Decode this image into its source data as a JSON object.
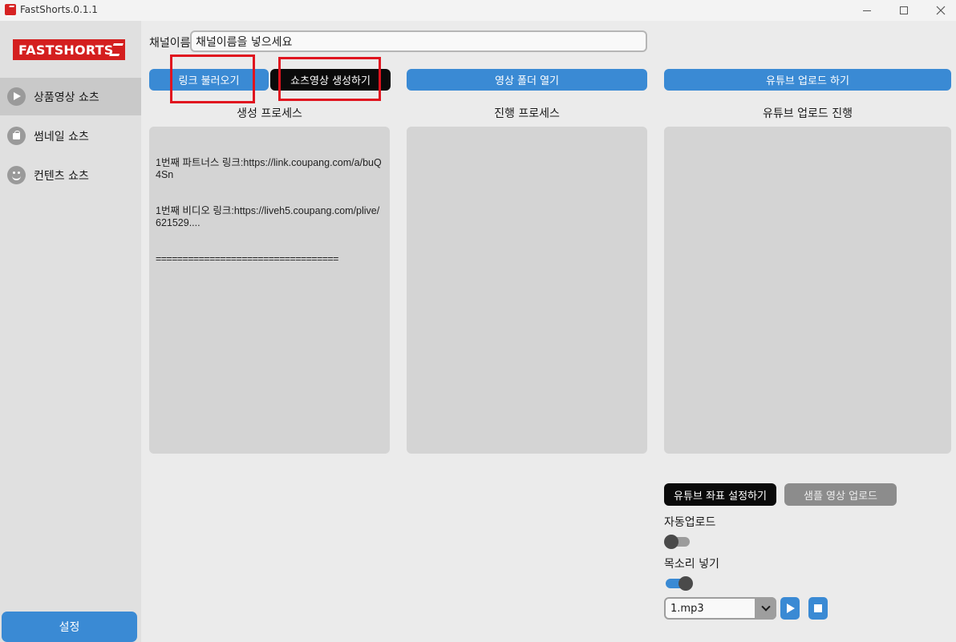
{
  "window": {
    "title": "FastShorts.0.1.1",
    "controls": [
      "minimize",
      "maximize",
      "close"
    ]
  },
  "sidebar": {
    "logo_text": "FASTSHORTS",
    "items": [
      {
        "label": "상품영상 쇼츠",
        "icon": "play-icon",
        "active": true
      },
      {
        "label": "썸네일 쇼츠",
        "icon": "bag-icon",
        "active": false
      },
      {
        "label": "컨텐츠 쇼츠",
        "icon": "smile-icon",
        "active": false
      }
    ],
    "settings_label": "설정"
  },
  "channel": {
    "label": "채널이름",
    "value": "채널이름을 넣으세요"
  },
  "buttons": {
    "load_links": "링크 불러오기",
    "create_shorts": "쇼츠영상 생성하기",
    "open_folder": "영상 폴더 열기",
    "youtube_upload": "유튜브 업로드 하기",
    "set_coords": "유튜브 좌표 설정하기",
    "sample_upload": "샘플 영상 업로드"
  },
  "sections": {
    "create_process": "생성 프로세스",
    "progress_process": "진행 프로세스",
    "upload_progress": "유튜브 업로드 진행"
  },
  "log_lines": [
    "1번째 파트너스 링크:https://link.coupang.com/a/buQ4Sn",
    "1번째 비디오 링크:https://liveh5.coupang.com/plive/621529....",
    "=================================="
  ],
  "options": {
    "auto_upload_label": "자동업로드",
    "auto_upload_on": false,
    "voice_label": "목소리 넣기",
    "voice_on": true,
    "voice_file": "1.mp3"
  },
  "colors": {
    "accent": "#3a8ad4",
    "brand": "#d41f1f",
    "annotation": "#e0141f"
  }
}
